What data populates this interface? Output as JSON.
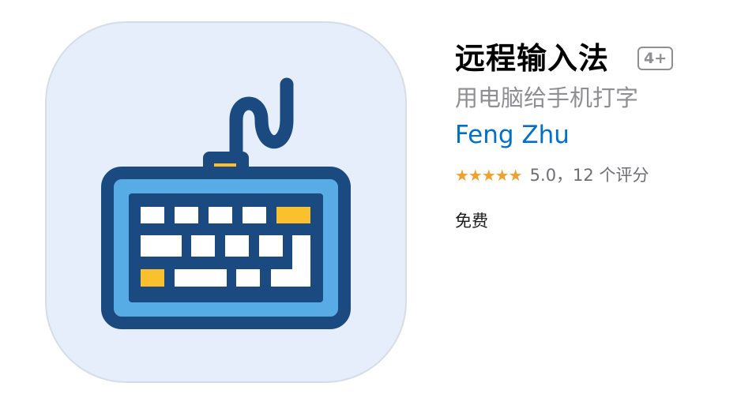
{
  "app": {
    "title": "远程输入法",
    "age_rating": "4+",
    "subtitle": "用电脑给手机打字",
    "developer": "Feng Zhu",
    "rating": {
      "stars": "★★★★★",
      "text": "5.0，12 个评分",
      "value": 5.0
    },
    "price": "免费"
  },
  "icon": {
    "name": "keyboard-icon",
    "colors": {
      "background": "#e5eefa",
      "outline": "#1a4a80",
      "keyboard_body": "#58ace5",
      "keys": "#ffffff",
      "accent_keys": "#fbc02d"
    }
  },
  "colors": {
    "developer_link": "#0070c9",
    "secondary_text": "#8e8e93",
    "stars": "#f0a030"
  }
}
